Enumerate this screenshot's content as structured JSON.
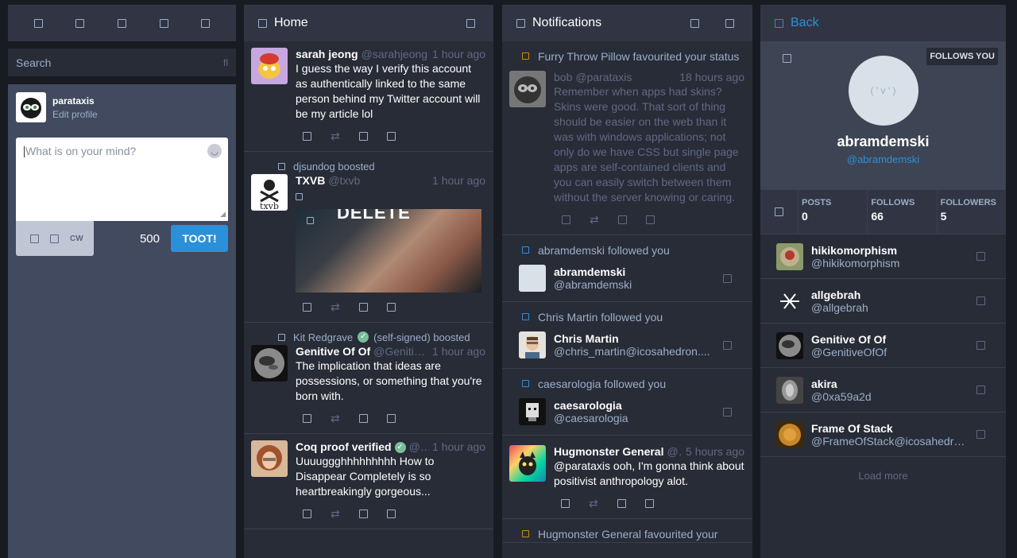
{
  "drawer": {
    "nav_icons": [
      "getting-started-icon",
      "home-icon",
      "notifications-icon",
      "public-icon",
      "settings-icon"
    ],
    "search_placeholder": "Search",
    "account": {
      "name": "parataxis",
      "edit_label": "Edit profile"
    },
    "compose": {
      "placeholder": "What is on your mind?",
      "cw_label": "CW",
      "char_count": "500",
      "submit_label": "TOOT!"
    }
  },
  "home": {
    "title": "Home",
    "statuses": [
      {
        "display_name": "sarah jeong",
        "username": "@sarahjeong",
        "time": "1 hour ago",
        "text": "I guess the way I verify this account as authentically linked to the same person behind my Twitter account will be my article lol"
      },
      {
        "boosted_by": "djsundog boosted",
        "display_name": "TXVB",
        "username": "@txvb",
        "time": "1 hour ago",
        "media_caption": "DELETE"
      },
      {
        "boosted_by_name": "Kit Redgrave",
        "boosted_by_suffix": "(self-signed) boosted",
        "display_name": "Genitive Of Of",
        "username": "@Genitive...",
        "time": "1 hour ago",
        "text": "The implication that ideas are possessions, or something that you're born with."
      },
      {
        "display_name": "Coq proof verified",
        "username": "@...",
        "time": "1 hour ago",
        "text": "Uuuuggghhhhhhhhh How to Disappear Completely is so heartbreakingly gorgeous..."
      }
    ]
  },
  "notifications": {
    "title": "Notifications",
    "items": [
      {
        "line": "Furry Throw Pillow favourited your status",
        "author": "bob",
        "username": "@parataxis",
        "time": "18 hours ago",
        "text": "Remember when apps had skins? Skins were good. That sort of thing should be easier on the web than it was with windows applications; not only do we have CSS but single page apps are self-contained clients and you can easily switch between them without the server knowing or caring."
      },
      {
        "line": "abramdemski followed you",
        "name": "abramdemski",
        "handle": "@abramdemski"
      },
      {
        "line": "Chris Martin followed you",
        "name": "Chris Martin",
        "handle": "@chris_martin@icosahedron...."
      },
      {
        "line": "caesarologia followed you",
        "name": "caesarologia",
        "handle": "@caesarologia"
      },
      {
        "display_name": "Hugmonster General",
        "username": "@...",
        "time": "5 hours ago",
        "mention": "@parataxis",
        "text": " ooh, I'm gonna think about positivist anthropology alot."
      },
      {
        "line": "Hugmonster General favourited your"
      }
    ]
  },
  "profile": {
    "back_label": "Back",
    "follows_you": "FOLLOWS YOU",
    "avatar_face": "( ' v ' )",
    "display_name": "abramdemski",
    "username": "@abramdemski",
    "stats": [
      {
        "label": "POSTS",
        "value": "0"
      },
      {
        "label": "FOLLOWS",
        "value": "66"
      },
      {
        "label": "FOLLOWERS",
        "value": "5"
      }
    ],
    "following": [
      {
        "name": "hikikomorphism",
        "handle": "@hikikomorphism"
      },
      {
        "name": "allgebrah",
        "handle": "@allgebrah"
      },
      {
        "name": "Genitive Of Of",
        "handle": "@GenitiveOfOf"
      },
      {
        "name": "akira",
        "handle": "@0xa59a2d"
      },
      {
        "name": "Frame Of Stack",
        "handle": "@FrameOfStack@icosahedro..."
      }
    ],
    "load_more": "Load more"
  },
  "colors": {
    "accent": "#2b90d9",
    "background": "#191b22",
    "column": "#282c37",
    "header": "#313543",
    "muted": "#606984",
    "secondary": "#9baec8",
    "favourite": "#ca8f04",
    "verified": "#79bd9a"
  }
}
